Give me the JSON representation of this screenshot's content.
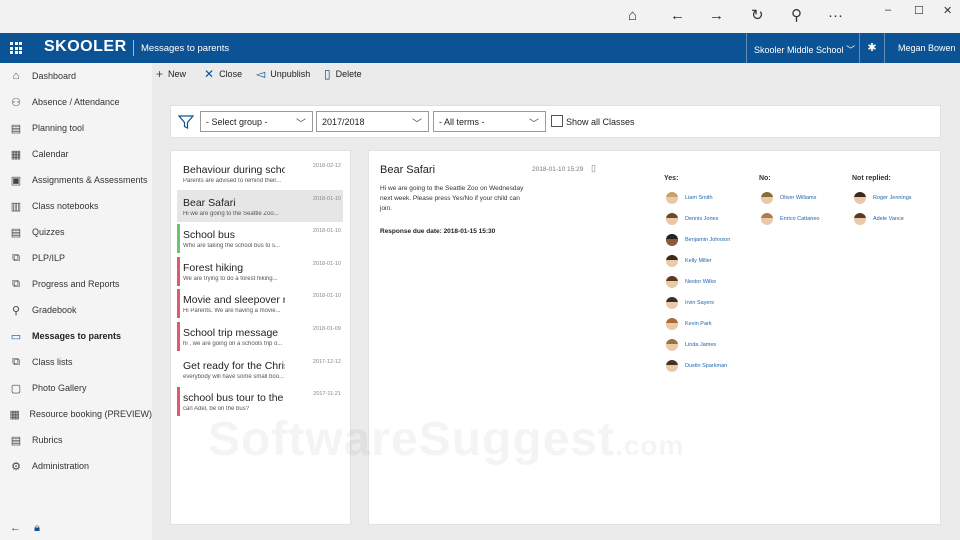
{
  "titlebar": {
    "icons": [
      "home-icon",
      "back-icon",
      "forward-icon",
      "refresh-icon",
      "search-icon",
      "more-icon"
    ],
    "window_buttons": [
      "minimize-icon",
      "maximize-icon",
      "close-icon"
    ]
  },
  "app": {
    "brand": "SKOOLER",
    "page_title": "Messages to parents",
    "school": "Skooler Middle School",
    "user": "Megan Bowen"
  },
  "sidebar": {
    "items": [
      {
        "label": "Dashboard",
        "icon": "home-icon"
      },
      {
        "label": "Absence / Attendance",
        "icon": "people-check-icon"
      },
      {
        "label": "Planning tool",
        "icon": "planner-icon"
      },
      {
        "label": "Calendar",
        "icon": "calendar-icon"
      },
      {
        "label": "Assignments & Assessments",
        "icon": "assignment-icon"
      },
      {
        "label": "Class notebooks",
        "icon": "notebook-icon"
      },
      {
        "label": "Quizzes",
        "icon": "quiz-icon"
      },
      {
        "label": "PLP/ILP",
        "icon": "plp-icon"
      },
      {
        "label": "Progress and Reports",
        "icon": "report-icon"
      },
      {
        "label": "Gradebook",
        "icon": "gradebook-icon"
      },
      {
        "label": "Messages to parents",
        "icon": "message-icon",
        "active": true
      },
      {
        "label": "Class lists",
        "icon": "class-list-icon"
      },
      {
        "label": "Photo Gallery",
        "icon": "photo-icon"
      },
      {
        "label": "Resource booking (PREVIEW)",
        "icon": "booking-icon"
      },
      {
        "label": "Rubrics",
        "icon": "rubric-icon"
      },
      {
        "label": "Administration",
        "icon": "admin-icon"
      }
    ]
  },
  "toolbar": {
    "new": "New",
    "close": "Close",
    "unpublish": "Unpublish",
    "delete": "Delete"
  },
  "filters": {
    "group": "- Select group -",
    "year": "2017/2018",
    "terms": "- All terms -",
    "show_all": "Show all Classes"
  },
  "messages": [
    {
      "title": "Behaviour during schoo",
      "preview": "Parents are advised to remind their...",
      "date": "2018-02-12",
      "bar": ""
    },
    {
      "title": "Bear Safari",
      "preview": "Hi we are going to the Seattle Zoo...",
      "date": "2018-01-10",
      "bar": "#e05a6a",
      "selected": true
    },
    {
      "title": "School bus",
      "preview": "Who are taking the school bus to s...",
      "date": "2018-01-10",
      "bar": "#6cc56c"
    },
    {
      "title": "Forest hiking",
      "preview": "We are trying to do a forest hiking...",
      "date": "2018-01-10",
      "bar": "#e05a6a"
    },
    {
      "title": "Movie and sleepover ni",
      "preview": "Hi Parents. We are having a movie...",
      "date": "2018-01-10",
      "bar": "#e05a6a"
    },
    {
      "title": "School trip message",
      "preview": "hi , we are going on a schools trip o...",
      "date": "2018-01-09",
      "bar": "#e05a6a"
    },
    {
      "title": "Get ready for the Christr",
      "preview": "everybody will have some small boo...",
      "date": "2017-12-12",
      "bar": ""
    },
    {
      "title": "school bus tour to the r",
      "preview": "can Adel, be on the bus?",
      "date": "2017-11-21",
      "bar": "#e05a6a"
    }
  ],
  "detail": {
    "title": "Bear Safari",
    "date": "2018-01-10 15:29",
    "body": "Hi we are going to the Seattle Zoo on Wednesday next week. Please press Yes/No if your child can join.",
    "due": "Response due date: 2018-01-15 15:30",
    "yes_label": "Yes:",
    "no_label": "No:",
    "not_replied_label": "Not replied:",
    "yes": [
      "Liam Smith",
      "Dennis Jones",
      "Benjamin Johnson",
      "Kelly Miller",
      "Nestor Wilke",
      "Irvin Sayers",
      "Kevin Park",
      "Linda James",
      "Dustin Sparkman"
    ],
    "no": [
      "Oliver Williams",
      "Enrico Cattaneo"
    ],
    "not_replied": [
      "Roger Jennings",
      "Adele Vance"
    ]
  },
  "watermark": {
    "main": "SoftwareSuggest",
    "suffix": ".com"
  }
}
